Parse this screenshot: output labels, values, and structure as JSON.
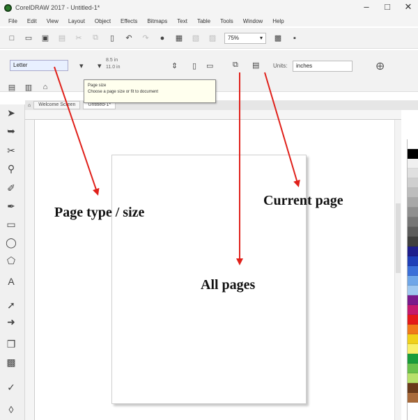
{
  "window": {
    "title": "CorelDRAW 2017 - Untitled-1*",
    "controls": [
      "–",
      "□",
      "✕"
    ]
  },
  "menubar": {
    "items": [
      "File",
      "Edit",
      "View",
      "Layout",
      "Object",
      "Effects",
      "Bitmaps",
      "Text",
      "Table",
      "Tools",
      "Window",
      "Help"
    ]
  },
  "toolbar": {
    "zoom": "75%"
  },
  "property_bar": {
    "page_size": "Letter",
    "width": "8.5 in",
    "height": "11.0 in",
    "units_label": "Units:",
    "units": "inches"
  },
  "tooltip": {
    "title": "Page size",
    "body": "Choose a page size or fit to document"
  },
  "doc_tabs": [
    "Welcome Screen",
    "Untitled-1*"
  ],
  "palette": {
    "colors": [
      "#ffffff",
      "#000000",
      "#f0f0f0",
      "#e0e0e0",
      "#cfcfcf",
      "#bdbdbd",
      "#a8a8a8",
      "#8f8f8f",
      "#767676",
      "#5c5c5c",
      "#3e3e3e",
      "#1e1e8c",
      "#1f3fb8",
      "#3b6fd8",
      "#6fa6e8",
      "#a0c8f0",
      "#7a1a8c",
      "#c41a6e",
      "#e41a1a",
      "#f07a1a",
      "#f0d01a",
      "#f8f06a",
      "#1a9c3a",
      "#6ac04a",
      "#b8e06a",
      "#6a3a1a",
      "#a86a3a"
    ]
  },
  "annotations": {
    "page_type": "Page type / size",
    "current_page": "Current page",
    "all_pages": "All pages",
    "arrow_color": "#e0201a"
  }
}
